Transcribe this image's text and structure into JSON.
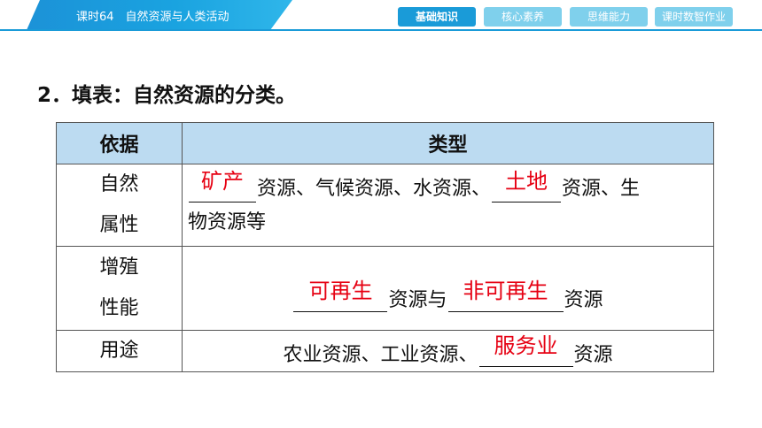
{
  "header": {
    "lesson_title": "课时64　自然资源与人类活动",
    "nav": [
      "基础知识",
      "核心素养",
      "思维能力",
      "课时数智作业"
    ],
    "accent_color": "#1a9bd8",
    "inactive_color": "#7fd0ec"
  },
  "question": {
    "heading": "2．填表：自然资源的分类。"
  },
  "table": {
    "headers": [
      "依据",
      "类型"
    ],
    "rows": [
      {
        "basis_line1": "自然",
        "basis_line2": "属性",
        "answer1": "矿产",
        "text1": "资源、气候资源、水资源、",
        "answer2": "土地",
        "text2": "资源、生",
        "text3": "物资源等"
      },
      {
        "basis_line1": "增殖",
        "basis_line2": "性能",
        "answer1": "可再生",
        "text1": "资源与",
        "answer2": "非可再生",
        "text2": "资源"
      },
      {
        "basis": "用途",
        "text1": "农业资源、工业资源、",
        "answer1": "服务业",
        "text2": "资源"
      }
    ],
    "answer_color": "#e60012",
    "header_bg": "#bcdbf1"
  }
}
